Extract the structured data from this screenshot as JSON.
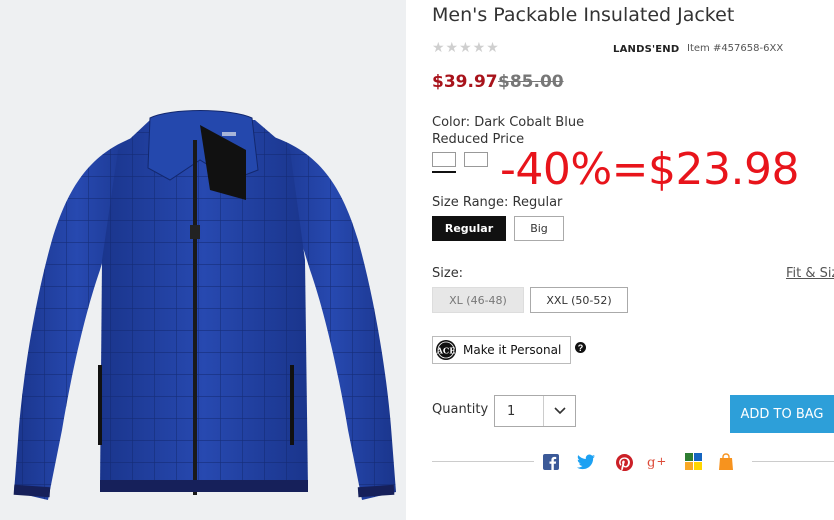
{
  "product": {
    "title": "Men's Packable Insulated Jacket",
    "rating_stars": "★★★★★",
    "brand": "LANDS'END",
    "item_number": "Item #457658-6XX"
  },
  "pricing": {
    "sale_price": "$39.97",
    "original_price": "$85.00",
    "promo_overlay": "-40%=$23.98"
  },
  "color": {
    "label": "Color: Dark Cobalt Blue",
    "note": "Reduced Price"
  },
  "size_range": {
    "label": "Size Range: Regular",
    "options": [
      "Regular",
      "Big"
    ],
    "selected": "Regular"
  },
  "size": {
    "label": "Size:",
    "fit_link": "Fit & Size",
    "options": [
      "XL (46-48)",
      "XXL (50-52)"
    ]
  },
  "personalize": {
    "label": "Make it Personal",
    "help": "?"
  },
  "quantity": {
    "label": "Quantity",
    "value": "1"
  },
  "actions": {
    "add_to_bag": "ADD TO BAG"
  },
  "share_icons": [
    "facebook-icon",
    "twitter-icon",
    "pinterest-icon",
    "google-plus-icon",
    "multicolor-squares-icon",
    "shopping-bag-icon"
  ],
  "colors": {
    "sale_red": "#a8131b",
    "promo_red": "#e8141b",
    "button_blue": "#2d9fd9",
    "jacket_blue": "#1f3f9e"
  }
}
